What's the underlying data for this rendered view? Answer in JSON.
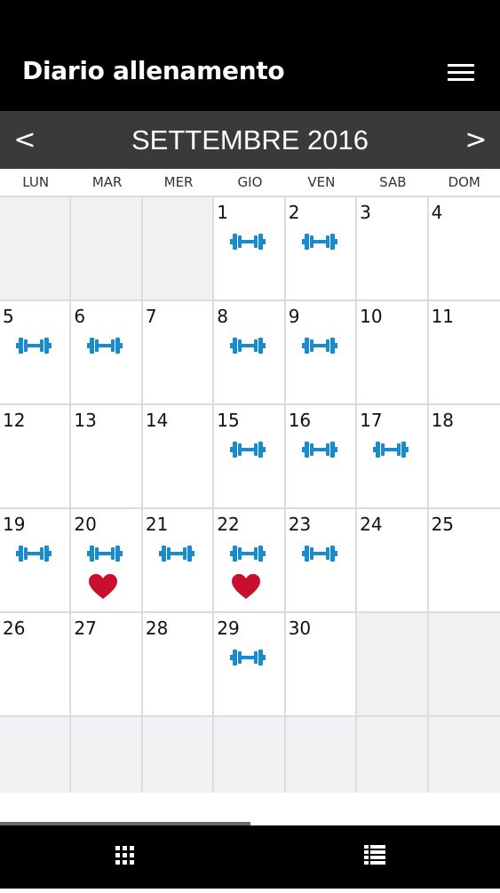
{
  "header": {
    "title": "Diario allenamento",
    "menu_icon": "hamburger-menu-icon"
  },
  "month_nav": {
    "prev_label": "<",
    "next_label": ">",
    "title": "SETTEMBRE 2016"
  },
  "weekdays": [
    "LUN",
    "MAR",
    "MER",
    "GIO",
    "VEN",
    "SAB",
    "DOM"
  ],
  "colors": {
    "dumbbell": "#1a8ccc",
    "heart": "#c8102e",
    "topbar": "#000000",
    "monthbar": "#3a3a3a",
    "empty_cell": "#f1f1f3"
  },
  "calendar": {
    "cells": [
      {
        "day": ""
      },
      {
        "day": ""
      },
      {
        "day": ""
      },
      {
        "day": "1",
        "workout": true
      },
      {
        "day": "2",
        "workout": true
      },
      {
        "day": "3"
      },
      {
        "day": "4"
      },
      {
        "day": "5",
        "workout": true
      },
      {
        "day": "6",
        "workout": true
      },
      {
        "day": "7"
      },
      {
        "day": "8",
        "workout": true
      },
      {
        "day": "9",
        "workout": true
      },
      {
        "day": "10"
      },
      {
        "day": "11"
      },
      {
        "day": "12"
      },
      {
        "day": "13"
      },
      {
        "day": "14"
      },
      {
        "day": "15",
        "workout": true
      },
      {
        "day": "16",
        "workout": true
      },
      {
        "day": "17",
        "workout": true
      },
      {
        "day": "18"
      },
      {
        "day": "19",
        "workout": true
      },
      {
        "day": "20",
        "workout": true,
        "heart": true
      },
      {
        "day": "21",
        "workout": true
      },
      {
        "day": "22",
        "workout": true,
        "heart": true
      },
      {
        "day": "23",
        "workout": true
      },
      {
        "day": "24"
      },
      {
        "day": "25"
      },
      {
        "day": "26"
      },
      {
        "day": "27"
      },
      {
        "day": "28"
      },
      {
        "day": "29",
        "workout": true
      },
      {
        "day": "30"
      },
      {
        "day": ""
      },
      {
        "day": ""
      },
      {
        "day": ""
      },
      {
        "day": ""
      },
      {
        "day": ""
      },
      {
        "day": ""
      },
      {
        "day": ""
      },
      {
        "day": ""
      },
      {
        "day": ""
      }
    ]
  },
  "bottom_nav": {
    "tabs": [
      {
        "icon": "grid-view-icon"
      },
      {
        "icon": "list-view-icon"
      }
    ]
  }
}
